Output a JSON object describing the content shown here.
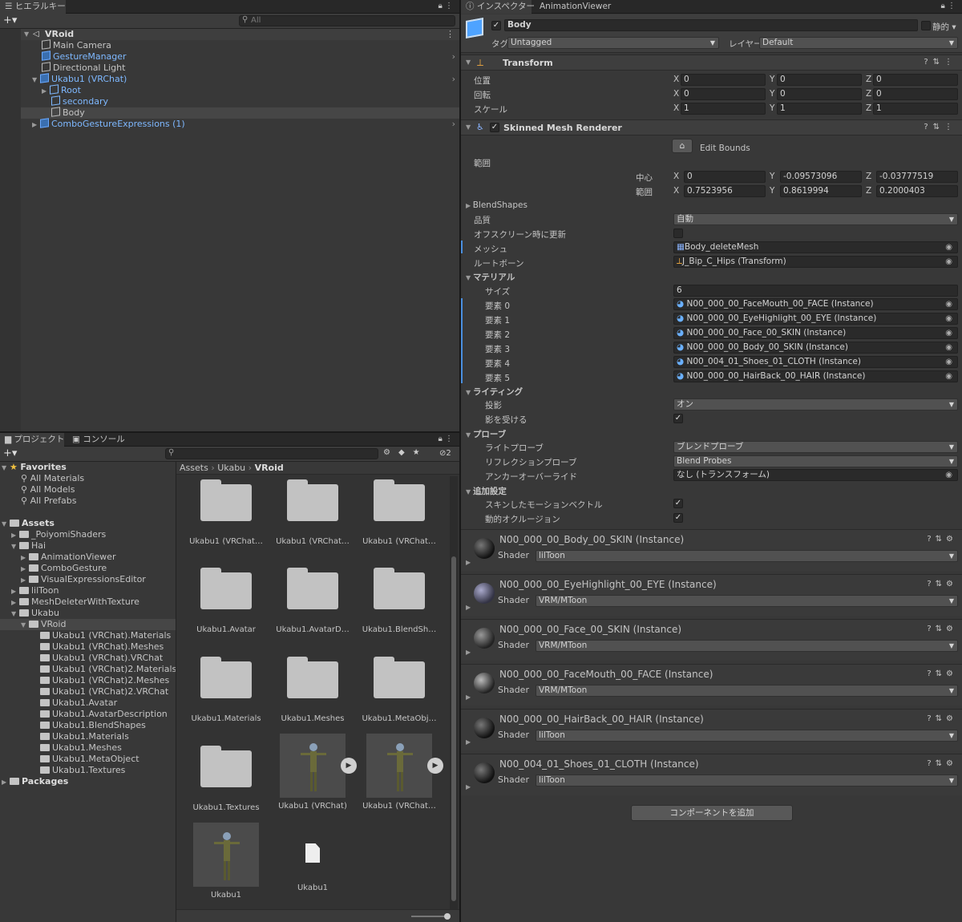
{
  "hierarchy": {
    "tab": "ヒエラルキー",
    "search_placeholder": "All",
    "scene": "VRoid",
    "items": [
      {
        "label": "Main Camera"
      },
      {
        "label": "GestureManager"
      },
      {
        "label": "Directional Light"
      },
      {
        "label": "Ukabu1 (VRChat)"
      },
      {
        "label": "Root"
      },
      {
        "label": "secondary"
      },
      {
        "label": "Body"
      },
      {
        "label": "ComboGestureExpressions (1)"
      }
    ]
  },
  "project": {
    "tab_project": "プロジェクト",
    "tab_console": "コンソール",
    "hidden_count": "2",
    "favorites": {
      "label": "Favorites",
      "items": [
        "All Materials",
        "All Models",
        "All Prefabs"
      ]
    },
    "assets": {
      "label": "Assets",
      "items": [
        "_PoiyomiShaders",
        "Hai",
        "AnimationViewer",
        "ComboGesture",
        "VisualExpressionsEditor",
        "lilToon",
        "MeshDeleterWithTexture",
        "Ukabu",
        "VRoid",
        "Ukabu1 (VRChat).Materials",
        "Ukabu1 (VRChat).Meshes",
        "Ukabu1 (VRChat).VRChat",
        "Ukabu1 (VRChat)2.Materials",
        "Ukabu1 (VRChat)2.Meshes",
        "Ukabu1 (VRChat)2.VRChat",
        "Ukabu1.Avatar",
        "Ukabu1.AvatarDescription",
        "Ukabu1.BlendShapes",
        "Ukabu1.Materials",
        "Ukabu1.Meshes",
        "Ukabu1.MetaObject",
        "Ukabu1.Textures"
      ]
    },
    "packages": "Packages",
    "breadcrumb": [
      "Assets",
      "Ukabu",
      "VRoid"
    ],
    "grid": [
      "Ukabu1 (VRChat…",
      "Ukabu1 (VRChat…",
      "Ukabu1 (VRChat…",
      "Ukabu1.Avatar",
      "Ukabu1.AvatarD…",
      "Ukabu1.BlendSh…",
      "Ukabu1.Materials",
      "Ukabu1.Meshes",
      "Ukabu1.MetaObj…",
      "Ukabu1.Textures",
      "Ukabu1 (VRChat)",
      "Ukabu1 (VRChat…",
      "Ukabu1",
      "Ukabu1"
    ]
  },
  "inspector": {
    "tab": "インスペクター",
    "tab2": "AnimationViewer",
    "object_name": "Body",
    "static_label": "静的",
    "tag_label": "タグ",
    "tag_value": "Untagged",
    "layer_label": "レイヤー",
    "layer_value": "Default",
    "transform": {
      "title": "Transform",
      "pos_label": "位置",
      "rot_label": "回転",
      "scale_label": "スケール",
      "pos": [
        "0",
        "0",
        "0"
      ],
      "rot": [
        "0",
        "0",
        "0"
      ],
      "scale": [
        "1",
        "1",
        "1"
      ]
    },
    "smr": {
      "title": "Skinned Mesh Renderer",
      "edit_bounds": "Edit Bounds",
      "bounds_label": "範囲",
      "center_label": "中心",
      "extent_label": "範囲",
      "center": [
        "0",
        "-0.09573096",
        "-0.03777519"
      ],
      "extent": [
        "0.7523956",
        "0.8619994",
        "0.2000403"
      ],
      "blendshapes": "BlendShapes",
      "quality_label": "品質",
      "quality_value": "自動",
      "offscreen_label": "オフスクリーン時に更新",
      "mesh_label": "メッシュ",
      "mesh_value": "Body_deleteMesh",
      "rootbone_label": "ルートボーン",
      "rootbone_value": "J_Bip_C_Hips (Transform)",
      "materials_label": "マテリアル",
      "size_label": "サイズ",
      "size_value": "6",
      "elements": [
        {
          "label": "要素 0",
          "value": "N00_000_00_FaceMouth_00_FACE (Instance)"
        },
        {
          "label": "要素 1",
          "value": "N00_000_00_EyeHighlight_00_EYE (Instance)"
        },
        {
          "label": "要素 2",
          "value": "N00_000_00_Face_00_SKIN (Instance)"
        },
        {
          "label": "要素 3",
          "value": "N00_000_00_Body_00_SKIN (Instance)"
        },
        {
          "label": "要素 4",
          "value": "N00_004_01_Shoes_01_CLOTH (Instance)"
        },
        {
          "label": "要素 5",
          "value": "N00_000_00_HairBack_00_HAIR (Instance)"
        }
      ],
      "lighting_label": "ライティング",
      "cast_label": "投影",
      "cast_value": "オン",
      "receive_label": "影を受ける",
      "probes_label": "プローブ",
      "lightprobe_label": "ライトプローブ",
      "lightprobe_value": "ブレンドプローブ",
      "reflprobe_label": "リフレクションプローブ",
      "reflprobe_value": "Blend Probes",
      "anchor_label": "アンカーオーバーライド",
      "anchor_value": "なし (トランスフォーム)",
      "extra_label": "追加設定",
      "skinned_motion_label": "スキンしたモーションベクトル",
      "dynamic_occ_label": "動的オクルージョン"
    },
    "materials": [
      {
        "name": "N00_000_00_Body_00_SKIN (Instance)",
        "shader": "lilToon"
      },
      {
        "name": "N00_000_00_EyeHighlight_00_EYE (Instance)",
        "shader": "VRM/MToon"
      },
      {
        "name": "N00_000_00_Face_00_SKIN (Instance)",
        "shader": "VRM/MToon"
      },
      {
        "name": "N00_000_00_FaceMouth_00_FACE (Instance)",
        "shader": "VRM/MToon"
      },
      {
        "name": "N00_000_00_HairBack_00_HAIR (Instance)",
        "shader": "lilToon"
      },
      {
        "name": "N00_004_01_Shoes_01_CLOTH (Instance)",
        "shader": "lilToon"
      }
    ],
    "shader_label": "Shader",
    "add_component": "コンポーネントを追加"
  }
}
